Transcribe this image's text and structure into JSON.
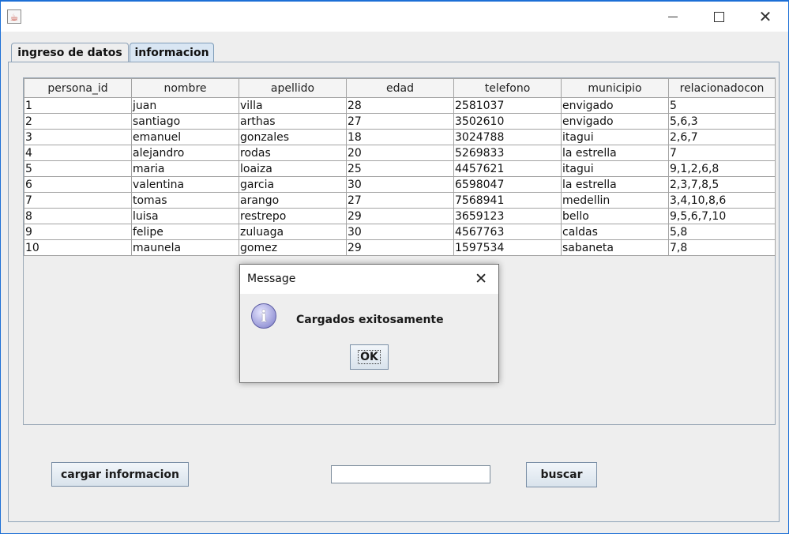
{
  "window": {
    "icon": "java-app-icon"
  },
  "tabs": [
    {
      "label": "ingreso de datos"
    },
    {
      "label": "informacion"
    }
  ],
  "table": {
    "columns": [
      "persona_id",
      "nombre",
      "apellido",
      "edad",
      "telefono",
      "municipio",
      "relacionadocon"
    ],
    "rows": [
      [
        "1",
        "juan",
        "villa",
        "28",
        "2581037",
        "envigado",
        "5"
      ],
      [
        "2",
        "santiago",
        "arthas",
        "27",
        "3502610",
        "envigado",
        "5,6,3"
      ],
      [
        "3",
        "emanuel",
        "gonzales",
        "18",
        "3024788",
        "itagui",
        "2,6,7"
      ],
      [
        "4",
        "alejandro",
        "rodas",
        "20",
        "5269833",
        "la estrella",
        "7"
      ],
      [
        "5",
        "maria",
        "loaiza",
        "25",
        "4457621",
        "itagui",
        "9,1,2,6,8"
      ],
      [
        "6",
        "valentina",
        "garcia",
        "30",
        "6598047",
        "la estrella",
        "2,3,7,8,5"
      ],
      [
        "7",
        "tomas",
        "arango",
        "27",
        "7568941",
        "medellin",
        "3,4,10,8,6"
      ],
      [
        "8",
        "luisa",
        "restrepo",
        "29",
        "3659123",
        "bello",
        "9,5,6,7,10"
      ],
      [
        "9",
        "felipe",
        "zuluaga",
        "30",
        "4567763",
        "caldas",
        "5,8"
      ],
      [
        "10",
        "maunela",
        "gomez",
        "29",
        "1597534",
        "sabaneta",
        "7,8"
      ]
    ]
  },
  "buttons": {
    "cargar": "cargar informacion",
    "buscar": "buscar"
  },
  "search": {
    "value": ""
  },
  "dialog": {
    "title": "Message",
    "message": "Cargados exitosamente",
    "ok": "OK",
    "icon": "information-icon"
  }
}
